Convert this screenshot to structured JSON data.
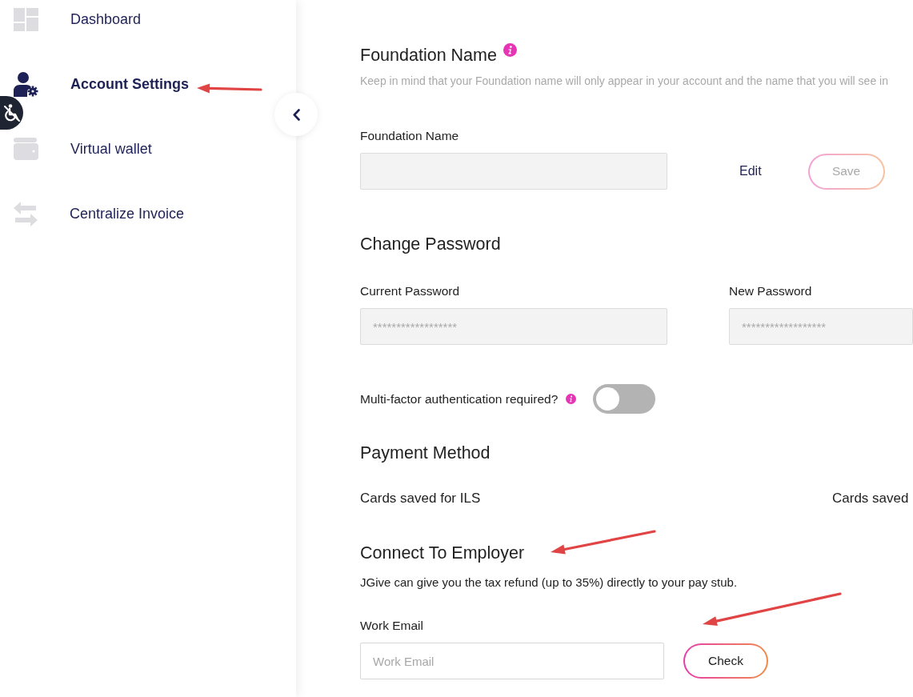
{
  "sidebar": {
    "items": [
      {
        "label": "Dashboard",
        "selected": false
      },
      {
        "label": "Account Settings",
        "selected": true
      },
      {
        "label": "Virtual wallet",
        "selected": false
      },
      {
        "label": "Centralize Invoice",
        "selected": false
      }
    ]
  },
  "foundation_name": {
    "heading": "Foundation Name",
    "note": "Keep in mind that your Foundation name will only appear in your account and the name that you will see in",
    "label": "Foundation Name",
    "edit_link": "Edit",
    "save_button": {
      "label": "Save",
      "disabled": true
    }
  },
  "change_password": {
    "heading": "Change Password",
    "fields": [
      {
        "label": "Current Password",
        "placeholder": "******************"
      },
      {
        "label": "New Password",
        "placeholder": "******************"
      }
    ]
  },
  "mfa": {
    "label": "Multi-factor authentication required?",
    "on": false
  },
  "payment_method": {
    "heading": "Payment Method",
    "columns": [
      "Cards saved for ILS",
      "Cards saved"
    ]
  },
  "connect_to_employer": {
    "heading": "Connect To Employer",
    "description": "JGive can give you the tax refund (up to 35%) directly to your pay stub.",
    "field": {
      "label": "Work Email",
      "placeholder": "Work Email"
    },
    "check_button": {
      "label": "Check",
      "disabled": false
    }
  }
}
